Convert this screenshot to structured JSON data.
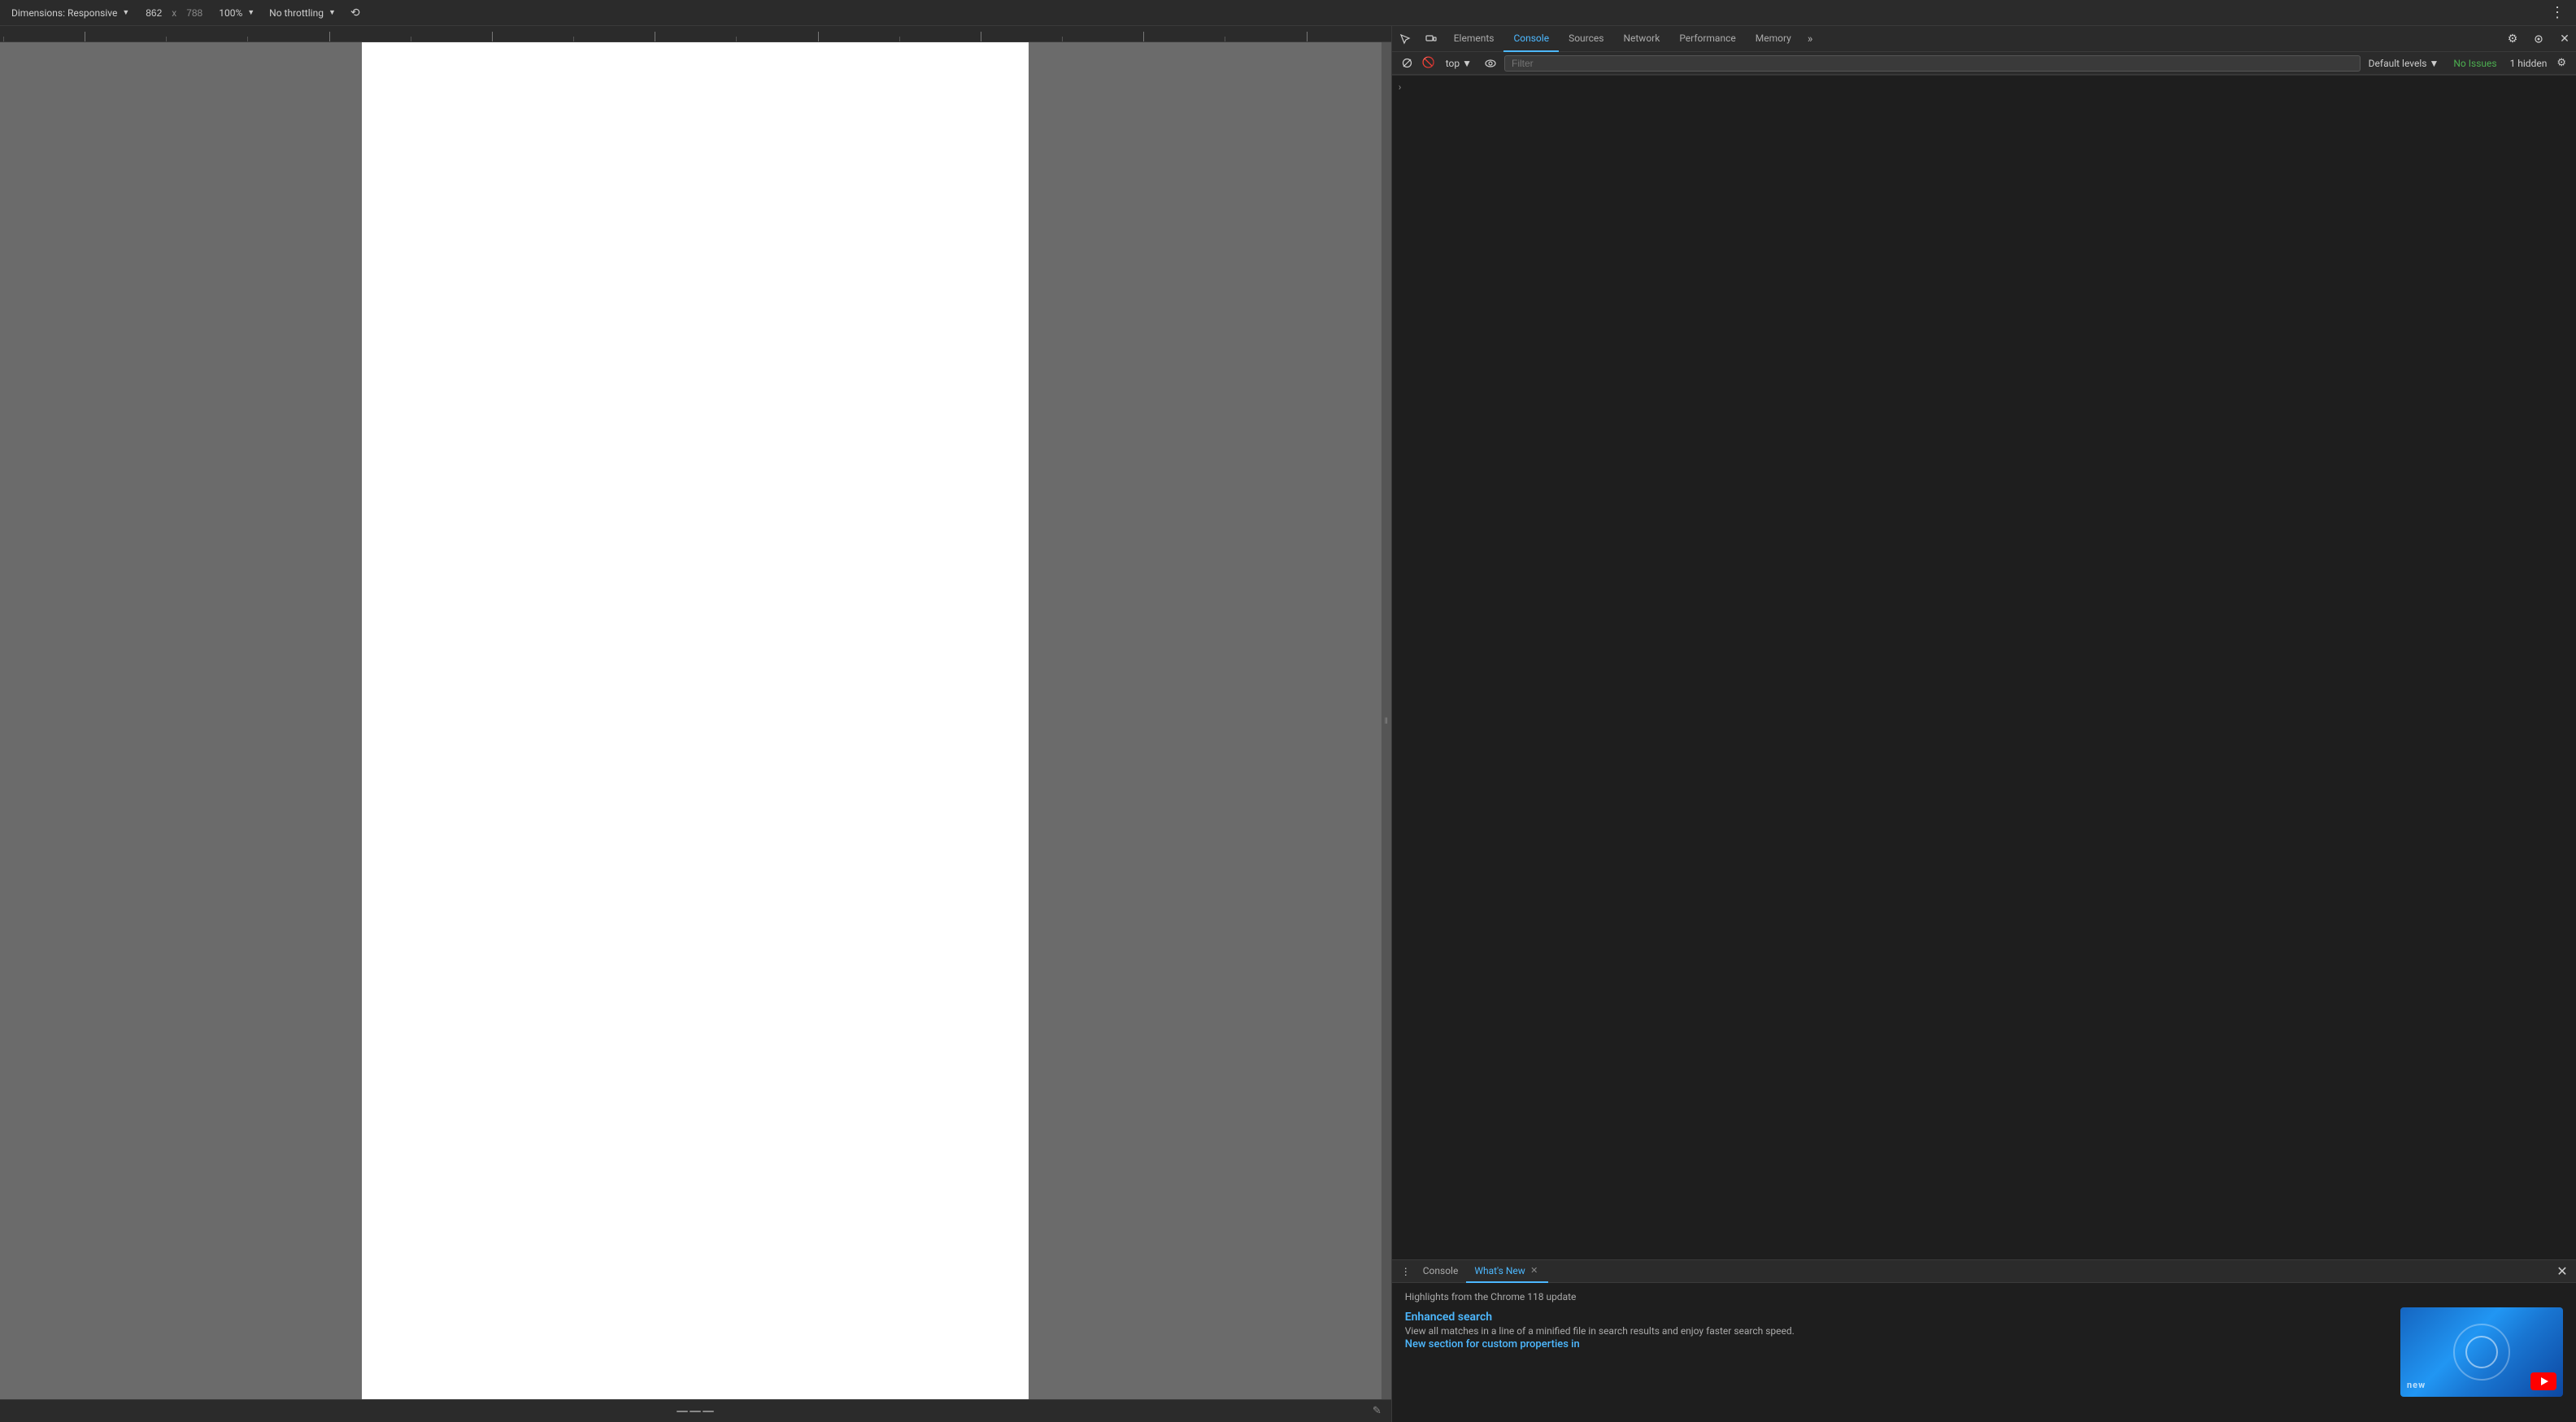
{
  "toolbar": {
    "dimensions_label": "Dimensions: Responsive",
    "width_value": "862",
    "height_value": "788",
    "zoom_value": "100%",
    "throttling_value": "No throttling",
    "more_label": "⋮"
  },
  "devtools": {
    "tabs": [
      {
        "label": "Elements",
        "id": "elements",
        "active": false
      },
      {
        "label": "Console",
        "id": "console",
        "active": true
      },
      {
        "label": "Sources",
        "id": "sources",
        "active": false
      },
      {
        "label": "Network",
        "id": "network",
        "active": false
      },
      {
        "label": "Performance",
        "id": "performance",
        "active": false
      },
      {
        "label": "Memory",
        "id": "memory",
        "active": false
      }
    ],
    "more_tabs_label": "»"
  },
  "console": {
    "context": "top",
    "filter_placeholder": "Filter",
    "levels_label": "Default levels",
    "no_issues_label": "No Issues",
    "hidden_label": "1 hidden"
  },
  "drawer": {
    "console_tab": "Console",
    "whats_new_tab": "What's New",
    "headline": "Highlights from the Chrome 118 update",
    "section1_title": "Enhanced search",
    "section1_desc": "View all matches in a line of a minified file in search results and enjoy faster search speed.",
    "section2_link": "New section for custom properties in",
    "video_new_label": "new"
  }
}
